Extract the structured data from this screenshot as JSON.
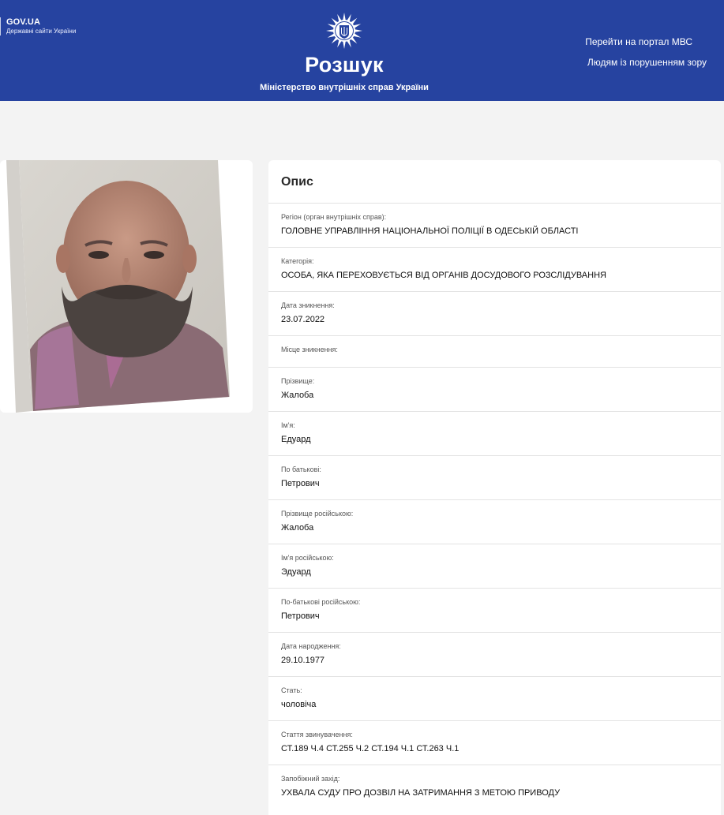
{
  "header": {
    "gov_title": "GOV.UA",
    "gov_subtitle": "Державні сайти України",
    "site_title": "Розшук",
    "site_subtitle": "Міністерство внутрішніх справ України",
    "links": [
      {
        "label": "Перейти на портал МВС"
      },
      {
        "label": "Людям із порушенням зору"
      }
    ],
    "background_color": "#2643a0"
  },
  "photo": {
    "icon": "portrait-photo"
  },
  "details": {
    "title": "Опис",
    "fields": [
      {
        "label": "Регіон (орган внутрішніх справ):",
        "value": "ГОЛОВНЕ УПРАВЛІННЯ НАЦІОНАЛЬНОЇ ПОЛІЦІЇ В ОДЕСЬКІЙ ОБЛАСТІ"
      },
      {
        "label": "Категорія:",
        "value": "ОСОБА, ЯКА ПЕРЕХОВУЄТЬСЯ ВІД ОРГАНІВ ДОСУДОВОГО РОЗСЛІДУВАННЯ"
      },
      {
        "label": "Дата зникнення:",
        "value": "23.07.2022"
      },
      {
        "label": "Місце зникнення:",
        "value": ""
      },
      {
        "label": "Прізвище:",
        "value": "Жалоба"
      },
      {
        "label": "Ім'я:",
        "value": "Едуард"
      },
      {
        "label": "По батькові:",
        "value": "Петрович"
      },
      {
        "label": "Прізвище російською:",
        "value": "Жалоба"
      },
      {
        "label": "Ім'я російською:",
        "value": "Эдуард"
      },
      {
        "label": "По-батькові російською:",
        "value": "Петрович"
      },
      {
        "label": "Дата народження:",
        "value": "29.10.1977"
      },
      {
        "label": "Стать:",
        "value": "чоловіча"
      },
      {
        "label": "Стаття звинувачення:",
        "value": "СТ.189 Ч.4 СТ.255 Ч.2 СТ.194 Ч.1 СТ.263 Ч.1"
      },
      {
        "label": "Запобіжний захід:",
        "value": "УХВАЛА СУДУ ПРО ДОЗВІЛ НА ЗАТРИМАННЯ З МЕТОЮ ПРИВОДУ"
      }
    ]
  }
}
